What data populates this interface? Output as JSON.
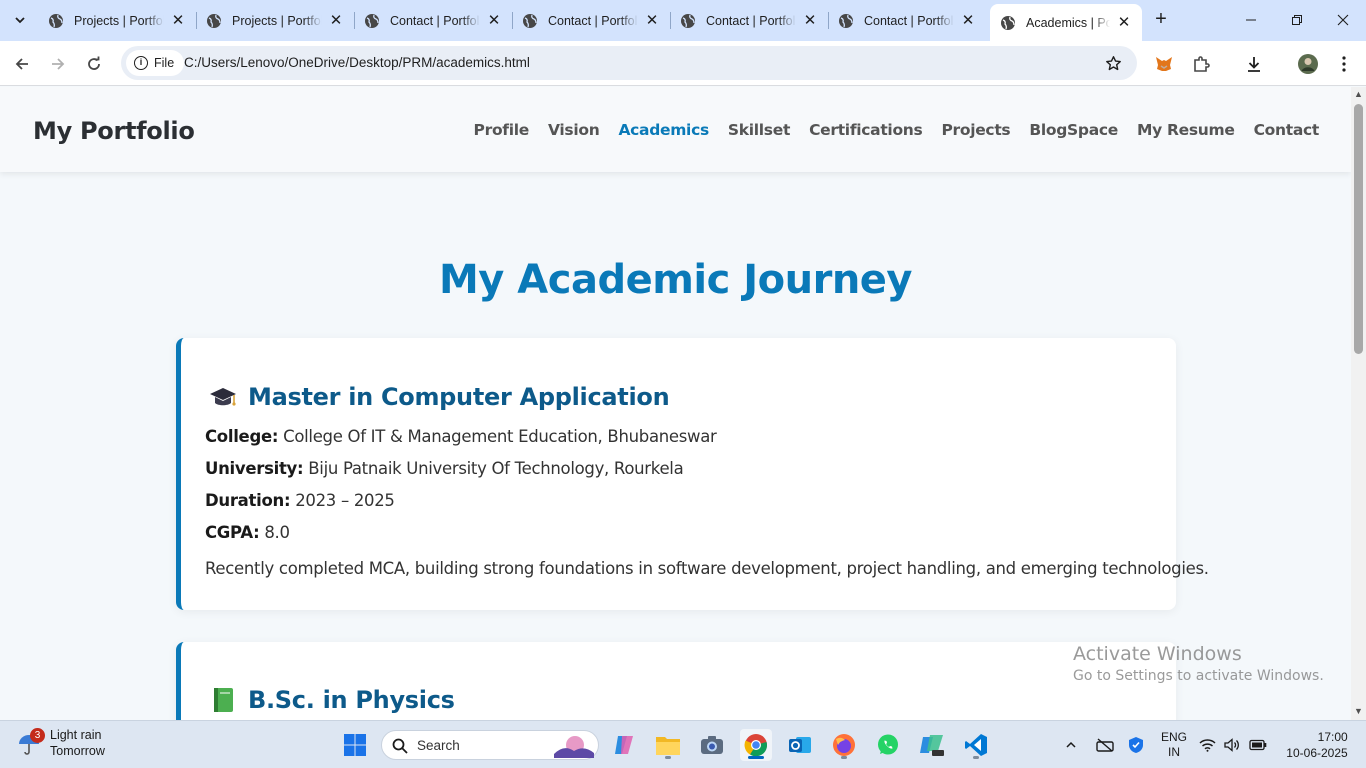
{
  "browser": {
    "tabs": [
      {
        "title": "Projects | Portfolio",
        "active": false
      },
      {
        "title": "Projects | Portfolio",
        "active": false
      },
      {
        "title": "Contact | Portfolio",
        "active": false
      },
      {
        "title": "Contact | Portfolio",
        "active": false
      },
      {
        "title": "Contact | Portfolio",
        "active": false
      },
      {
        "title": "Contact | Portfolio",
        "active": false
      },
      {
        "title": "Academics | Portfolio",
        "active": true
      }
    ],
    "close_glyph": "✕",
    "new_tab_glyph": "+",
    "scheme_chip": "File",
    "url": "C:/Users/Lenovo/OneDrive/Desktop/PRM/academics.html"
  },
  "site": {
    "brand": "My Portfolio",
    "nav": [
      "Profile",
      "Vision",
      "Academics",
      "Skillset",
      "Certifications",
      "Projects",
      "BlogSpace",
      "My Resume",
      "Contact"
    ],
    "active_nav": "Academics",
    "page_title": "My Academic Journey",
    "accent_color": "#0a79b8",
    "cards": [
      {
        "icon": "graduation-cap-icon",
        "heading": "Master in Computer Application",
        "college_label": "College:",
        "college": "College Of IT & Management Education, Bhubaneswar",
        "university_label": "University:",
        "university": "Biju Patnaik University Of Technology, Rourkela",
        "duration_label": "Duration:",
        "duration": "2023 – 2025",
        "cgpa_label": "CGPA:",
        "cgpa": "8.0",
        "description": "Recently completed MCA, building strong foundations in software development, project handling, and emerging technologies."
      },
      {
        "icon": "green-book-icon",
        "heading": "B.Sc. in Physics"
      }
    ]
  },
  "watermark": {
    "line1": "Activate Windows",
    "line2": "Go to Settings to activate Windows."
  },
  "taskbar": {
    "weather_badge": "3",
    "weather_line1": "Light rain",
    "weather_line2": "Tomorrow",
    "search_placeholder": "Search",
    "lang_line1": "ENG",
    "lang_line2": "IN",
    "time": "17:00",
    "date": "10-06-2025"
  }
}
